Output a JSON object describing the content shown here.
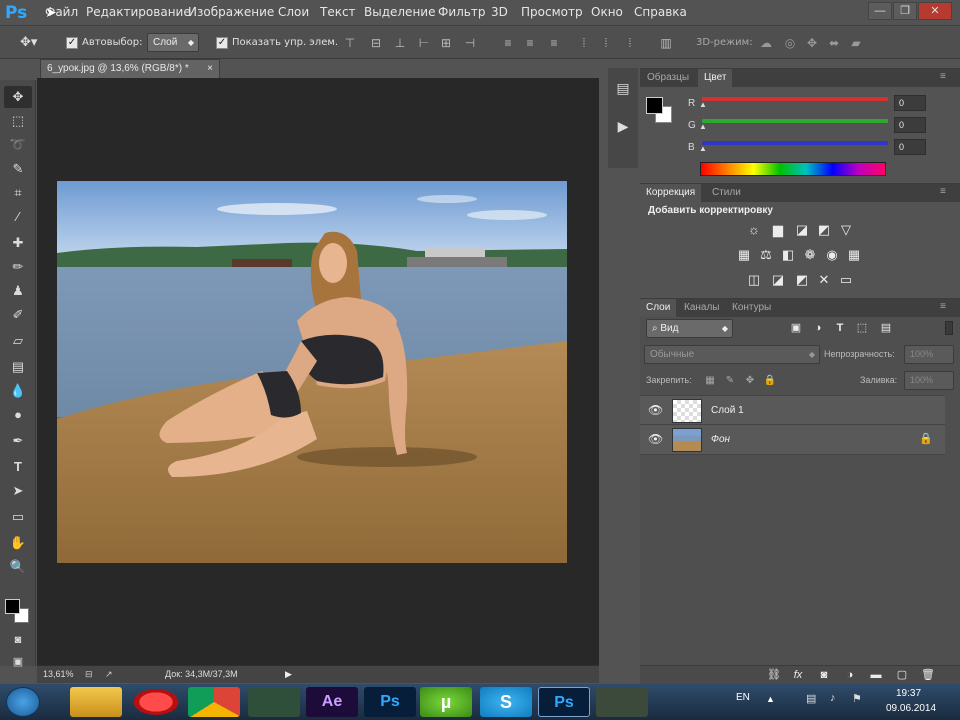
{
  "app": {
    "logo": "Ps"
  },
  "menu": [
    {
      "label": "Файл"
    },
    {
      "label": "Редактирование"
    },
    {
      "label": "Изображение"
    },
    {
      "label": "Слои"
    },
    {
      "label": "Текст"
    },
    {
      "label": "Выделение"
    },
    {
      "label": "Фильтр"
    },
    {
      "label": "3D"
    },
    {
      "label": "Просмотр"
    },
    {
      "label": "Окно"
    },
    {
      "label": "Справка"
    }
  ],
  "window_controls": {
    "minimize": "—",
    "restore": "❐",
    "close": "✕"
  },
  "options": {
    "autoselect_label": "Автовыбор:",
    "autoselect_value": "Слой",
    "show_transform_label": "Показать упр. элем.",
    "mode3d_label": "3D-режим:"
  },
  "document": {
    "tab_title": "6_урок.jpg @ 13,6% (RGB/8*) *",
    "close_glyph": "×",
    "zoom": "13,61%",
    "doc_info": "Док: 34,3M/37,3M"
  },
  "color_panel": {
    "tabs": [
      "Образцы",
      "Цвет"
    ],
    "channels": [
      {
        "label": "R",
        "value": "0",
        "color": "#d83030"
      },
      {
        "label": "G",
        "value": "0",
        "color": "#2ea82e"
      },
      {
        "label": "B",
        "value": "0",
        "color": "#2f37c8"
      }
    ]
  },
  "adjustments_panel": {
    "tabs": [
      "Коррекция",
      "Стили"
    ],
    "heading": "Добавить корректировку"
  },
  "layers_panel": {
    "tabs": [
      "Слои",
      "Каналы",
      "Контуры"
    ],
    "filter_value": "Вид",
    "blend_mode": "Обычные",
    "opacity_label": "Непрозрачность:",
    "opacity_value": "100%",
    "lock_label": "Закрепить:",
    "fill_label": "Заливка:",
    "fill_value": "100%",
    "layers": [
      {
        "name": "Слой 1",
        "visible": true,
        "locked": false
      },
      {
        "name": "Фон",
        "visible": true,
        "locked": true
      }
    ]
  },
  "taskbar": {
    "lang": "EN",
    "time": "19:37",
    "date": "09.06.2014",
    "apps": [
      "Windows Explorer",
      "Opera",
      "Chrome",
      "App",
      "Ae",
      "Ps",
      "µTorrent",
      "Skype",
      "Ps",
      "App"
    ]
  },
  "colors": {
    "accent": "#31a8ff",
    "panel": "#535353",
    "canvas_bg": "#282828"
  }
}
